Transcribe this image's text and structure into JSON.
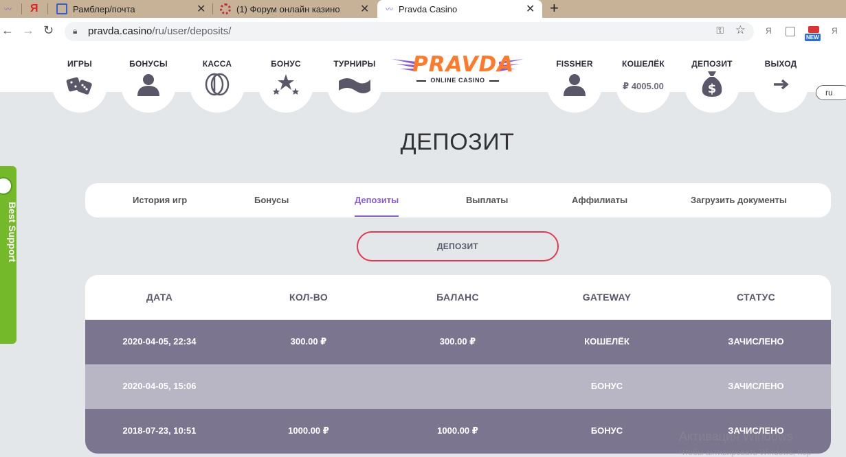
{
  "browser": {
    "tabs": [
      {
        "title": "Рамблер/почта"
      },
      {
        "title": "(1) Форум онлайн казино"
      },
      {
        "title": "Pravda Casino"
      }
    ],
    "pinned_label": "Я",
    "url_host": "pravda.casino",
    "url_path": "/ru/user/deposits/",
    "ext_label": "Я",
    "new_badge": "NEW"
  },
  "header": {
    "nav_left": [
      {
        "label": "ИГРЫ",
        "icon": "dice-icon"
      },
      {
        "label": "БОНУСЫ",
        "icon": "user-icon"
      },
      {
        "label": "КАССА",
        "icon": "chip-icon"
      },
      {
        "label": "БОНУС",
        "icon": "stars-icon"
      },
      {
        "label": "ТУРНИРЫ",
        "icon": "ribbon-icon"
      }
    ],
    "logo_brand": "PRAVDA",
    "logo_sub": "ONLINE CASINO",
    "nav_right": [
      {
        "label": "FISSHER",
        "icon": "user-icon"
      },
      {
        "label": "КОШЕЛЁК",
        "balance": "₽ 4005.00"
      },
      {
        "label": "ДЕПОЗИТ",
        "icon": "money-bag-icon"
      },
      {
        "label": "ВЫХОД",
        "icon": "arrow-right-icon"
      }
    ],
    "lang": "ru"
  },
  "support": {
    "label": "Best Support"
  },
  "page": {
    "title": "ДЕПОЗИТ",
    "tabs": [
      {
        "label": "История игр",
        "active": false
      },
      {
        "label": "Бонусы",
        "active": false
      },
      {
        "label": "Депозиты",
        "active": true
      },
      {
        "label": "Выплаты",
        "active": false
      },
      {
        "label": "Аффилиаты",
        "active": false
      },
      {
        "label": "Загрузить документы",
        "active": false
      }
    ],
    "deposit_button": "ДЕПОЗИТ"
  },
  "table": {
    "columns": [
      "ДАТА",
      "КОЛ-ВО",
      "БАЛАНС",
      "GATEWAY",
      "СТАТУС"
    ],
    "rows": [
      [
        "2020-04-05, 22:34",
        "300.00 ₽",
        "300.00 ₽",
        "КОШЕЛЁК",
        "ЗАЧИСЛЕНО"
      ],
      [
        "2020-04-05, 15:06",
        "",
        "",
        "БОНУС",
        "ЗАЧИСЛЕНО"
      ],
      [
        "2018-07-23, 10:51",
        "1000.00 ₽",
        "1000.00 ₽",
        "БОНУС",
        "ЗАЧИСЛЕНО"
      ]
    ]
  },
  "watermark": {
    "line1": "Активация Windows",
    "line2": "Чтобы активировать Windows, пер"
  },
  "colors": {
    "accent": "#8a5cd8",
    "logo": "#ff7a2a",
    "button_border": "#e2384f",
    "row_dark": "#7b7590",
    "row_light": "#b8b5c4",
    "support": "#74b92a"
  }
}
